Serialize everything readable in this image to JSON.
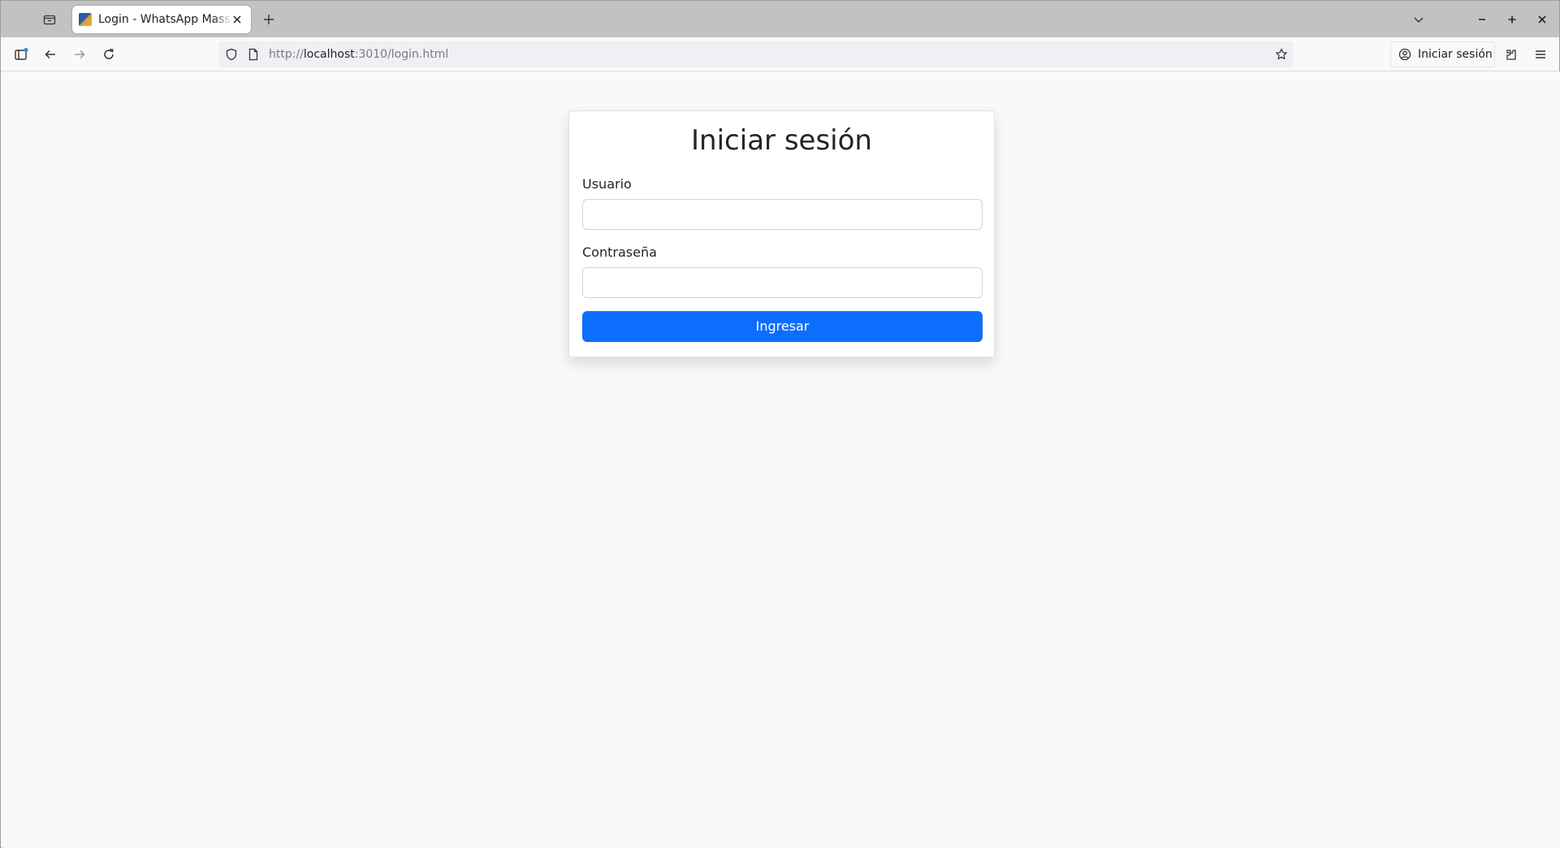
{
  "browser": {
    "tab": {
      "title": "Login - WhatsApp Massive",
      "favicon": "app-favicon"
    },
    "url": {
      "scheme": "http://",
      "host": "localhost",
      "rest": ":3010/login.html"
    },
    "signin_label": "Iniciar sesión",
    "icons": {
      "tab_list": "tab-list-icon",
      "new_tab": "plus-icon",
      "tabs_overflow": "chevron-down-icon",
      "minimize": "minimize-icon",
      "maximize": "maximize-icon",
      "close": "close-icon",
      "sidebar": "sidebar-icon",
      "back": "back-arrow-icon",
      "forward": "forward-arrow-icon",
      "reload": "reload-icon",
      "shield": "shield-icon",
      "page": "page-icon",
      "star": "star-icon",
      "account": "account-icon",
      "extensions": "extensions-icon",
      "menu": "hamburger-menu-icon"
    }
  },
  "login": {
    "title": "Iniciar sesión",
    "username_label": "Usuario",
    "username_value": "",
    "password_label": "Contraseña",
    "password_value": "",
    "submit_label": "Ingresar"
  },
  "colors": {
    "primary": "#0d6efd",
    "page_background": "#f8f9fa",
    "text": "#212529"
  }
}
